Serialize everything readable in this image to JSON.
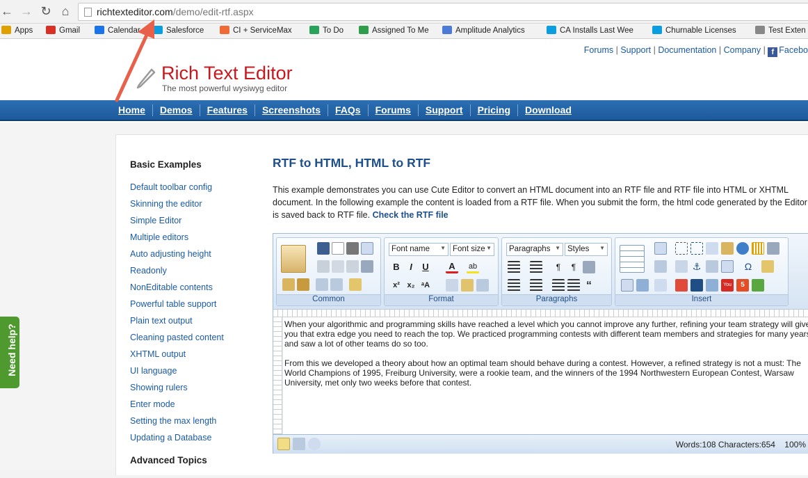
{
  "browser": {
    "url_domain": "richtexteditor.com",
    "url_path": "/demo/edit-rtf.aspx",
    "bookmarks": [
      "Apps",
      "Gmail",
      "Calendar",
      "Salesforce",
      "CI + ServiceMax",
      "To Do",
      "Assigned To Me",
      "Amplitude Analytics",
      "CA Installs Last Wee",
      "Churnable Licenses",
      "Test Exten"
    ],
    "bookmark_colors": [
      "#e0a000",
      "#d93025",
      "#1a73e8",
      "#0a9ee0",
      "#f06a35",
      "#29a35a",
      "#2f9d49",
      "#4b7bd6",
      "#0a9ee0",
      "#0a9ee0",
      "#888888"
    ]
  },
  "toplinks": [
    "Forums",
    "Support",
    "Documentation",
    "Company",
    "Facebo"
  ],
  "logo": {
    "title": "Rich Text Editor",
    "tagline": "The most powerful wysiwyg editor",
    "color": "#c8181e"
  },
  "nav": [
    "Home",
    "Demos",
    "Features",
    "Screenshots",
    "FAQs",
    "Forums",
    "Support",
    "Pricing",
    "Download"
  ],
  "sidebar": {
    "heading": "Basic Examples",
    "items": [
      "Default toolbar config",
      "Skinning the editor",
      "Simple Editor",
      "Multiple editors",
      "Auto adjusting height",
      "Readonly",
      "NonEditable contents",
      "Powerful table support",
      "Plain text output",
      "Cleaning pasted content",
      "XHTML output",
      "UI language",
      "Showing rulers",
      "Enter mode",
      "Setting the max length",
      "Updating a Database"
    ],
    "advanced_heading": "Advanced Topics"
  },
  "main": {
    "title": "RTF to HTML, HTML to RTF",
    "intro": "This example demonstrates you can use Cute Editor to convert an HTML document into an RTF file and RTF file into HTML or XHTML document. In the following example the content is loaded from a RTF file. When you submit the form, the html code generated by the Editor is saved back to RTF file.",
    "link": "Check the RTF file"
  },
  "editor": {
    "groups": [
      "Common",
      "Format",
      "Paragraphs",
      "Insert"
    ],
    "font_name": "Font name",
    "font_size": "Font size",
    "paragraphs": "Paragraphs",
    "styles": "Styles",
    "content": [
      "When your algorithmic and programming skills have reached a level which you cannot improve any further, refining your team strategy will give you that extra edge you need to reach the top. We practiced programming contests with different team members and strategies for many years, and saw a lot of other teams do so too.",
      "From this we developed a theory about how an optimal team should behave during a contest. However, a refined strategy is not a must: The World Champions of 1995, Freiburg University, were a rookie team, and the winners of the 1994 Northwestern European Contest, Warsaw University, met only two weeks before that contest."
    ],
    "status": "Words:108 Characters:654",
    "zoom": "100%"
  },
  "help": "Need help?",
  "accent": "#1d4f8c"
}
